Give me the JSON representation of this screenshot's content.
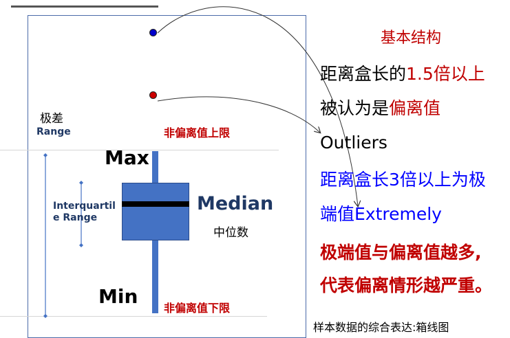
{
  "colors": {
    "accent_red": "#c00000",
    "accent_blue": "#0000ff",
    "box_blue": "#4472c4",
    "label_navy": "#1f3864",
    "outlier_extreme": "#0000cc",
    "outlier_mild": "#cc0000"
  },
  "labels": {
    "range_cn": "极差",
    "range_en": "Range",
    "upper_limit": "非偏离值上限",
    "lower_limit": "非偏离值下限",
    "max": "Max",
    "min": "Min",
    "iqr_line1": "Interquartil",
    "iqr_line2": "e Range",
    "median_en": "Median",
    "median_cn": "中位数"
  },
  "right_panel": {
    "title": "基本结构",
    "line1_black": "距离盒长的",
    "line1_red": "1.5倍以上",
    "line2_black": "被认为是",
    "line2_red": "偏离值",
    "line3": "Outliers",
    "line4": "距离盒长3倍以上为极",
    "line5": "端值Extremely",
    "line6": "极端值与偏离值越多,",
    "line7": "代表偏离情形越严重。"
  },
  "caption": "样本数据的综合表达:箱线图"
}
